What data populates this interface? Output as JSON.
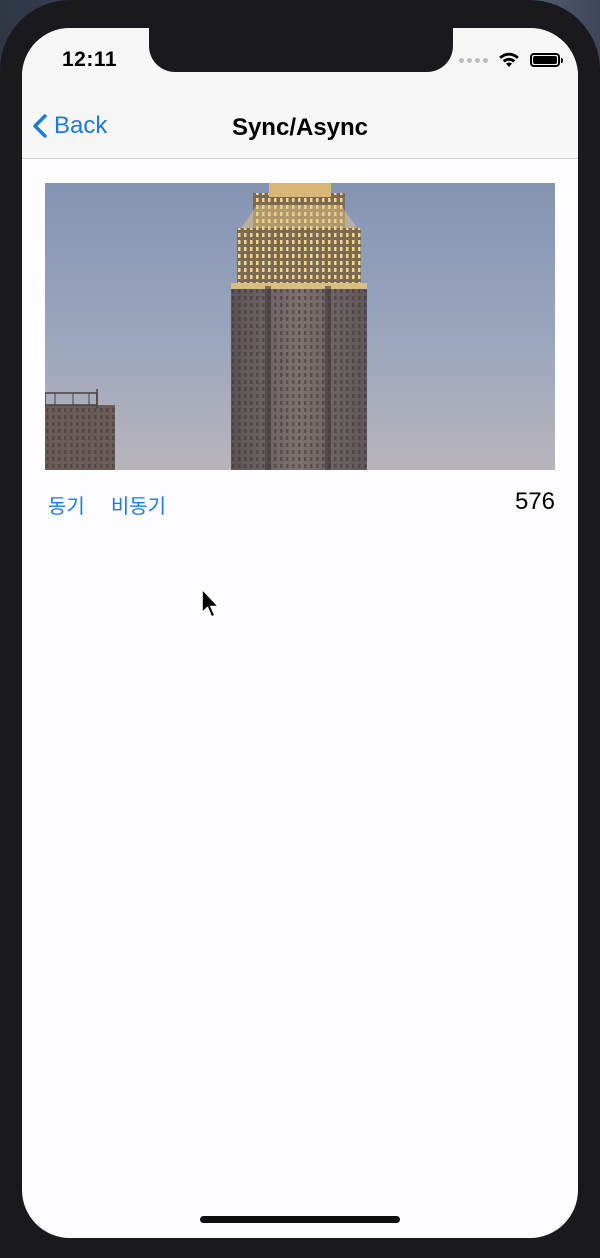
{
  "status_bar": {
    "time": "12:11",
    "icons": [
      "cellular-dots-icon",
      "wifi-icon",
      "battery-icon"
    ]
  },
  "nav_bar": {
    "back_label": "Back",
    "back_icon": "chevron-left-icon",
    "title": "Sync/Async"
  },
  "photo": {
    "subject": "empire-state-building-dusk-image"
  },
  "controls": {
    "sync_label": "동기",
    "async_label": "비동기",
    "count": "576"
  },
  "colors": {
    "accent": "#1a7bd8",
    "frame": "#1a191d",
    "bar_background": "#f6f6f7",
    "screen_background": "#fdfcff"
  }
}
